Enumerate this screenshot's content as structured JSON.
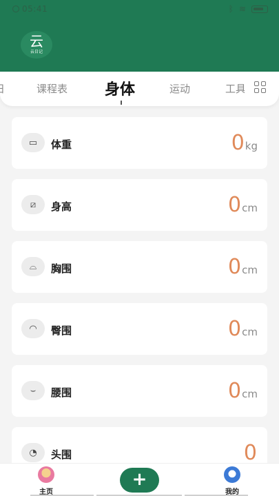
{
  "status": {
    "time": "05:41"
  },
  "header": {
    "logo_char": "云",
    "logo_text": "云日记"
  },
  "tabs": {
    "items": [
      {
        "label": "日"
      },
      {
        "label": "课程表"
      },
      {
        "label": "身体"
      },
      {
        "label": "运动"
      },
      {
        "label": "工具"
      }
    ],
    "active_index": 2
  },
  "cards": [
    {
      "label": "体重",
      "value": "0",
      "unit": "kg",
      "icon": "scale-icon",
      "glyph": "▭"
    },
    {
      "label": "身高",
      "value": "0",
      "unit": "cm",
      "icon": "ruler-icon",
      "glyph": "⧄"
    },
    {
      "label": "胸围",
      "value": "0",
      "unit": "cm",
      "icon": "chest-icon",
      "glyph": "⌓"
    },
    {
      "label": "臀围",
      "value": "0",
      "unit": "cm",
      "icon": "hip-icon",
      "glyph": "◠"
    },
    {
      "label": "腰围",
      "value": "0",
      "unit": "cm",
      "icon": "waist-icon",
      "glyph": "⌣"
    },
    {
      "label": "头围",
      "value": "0",
      "unit": "",
      "icon": "head-icon",
      "glyph": "◔"
    }
  ],
  "bottom_nav": {
    "home_label": "主页",
    "add_label": "+",
    "mine_label": "我的"
  },
  "colors": {
    "primary": "#1f7a54",
    "value": "#e08a5a"
  }
}
